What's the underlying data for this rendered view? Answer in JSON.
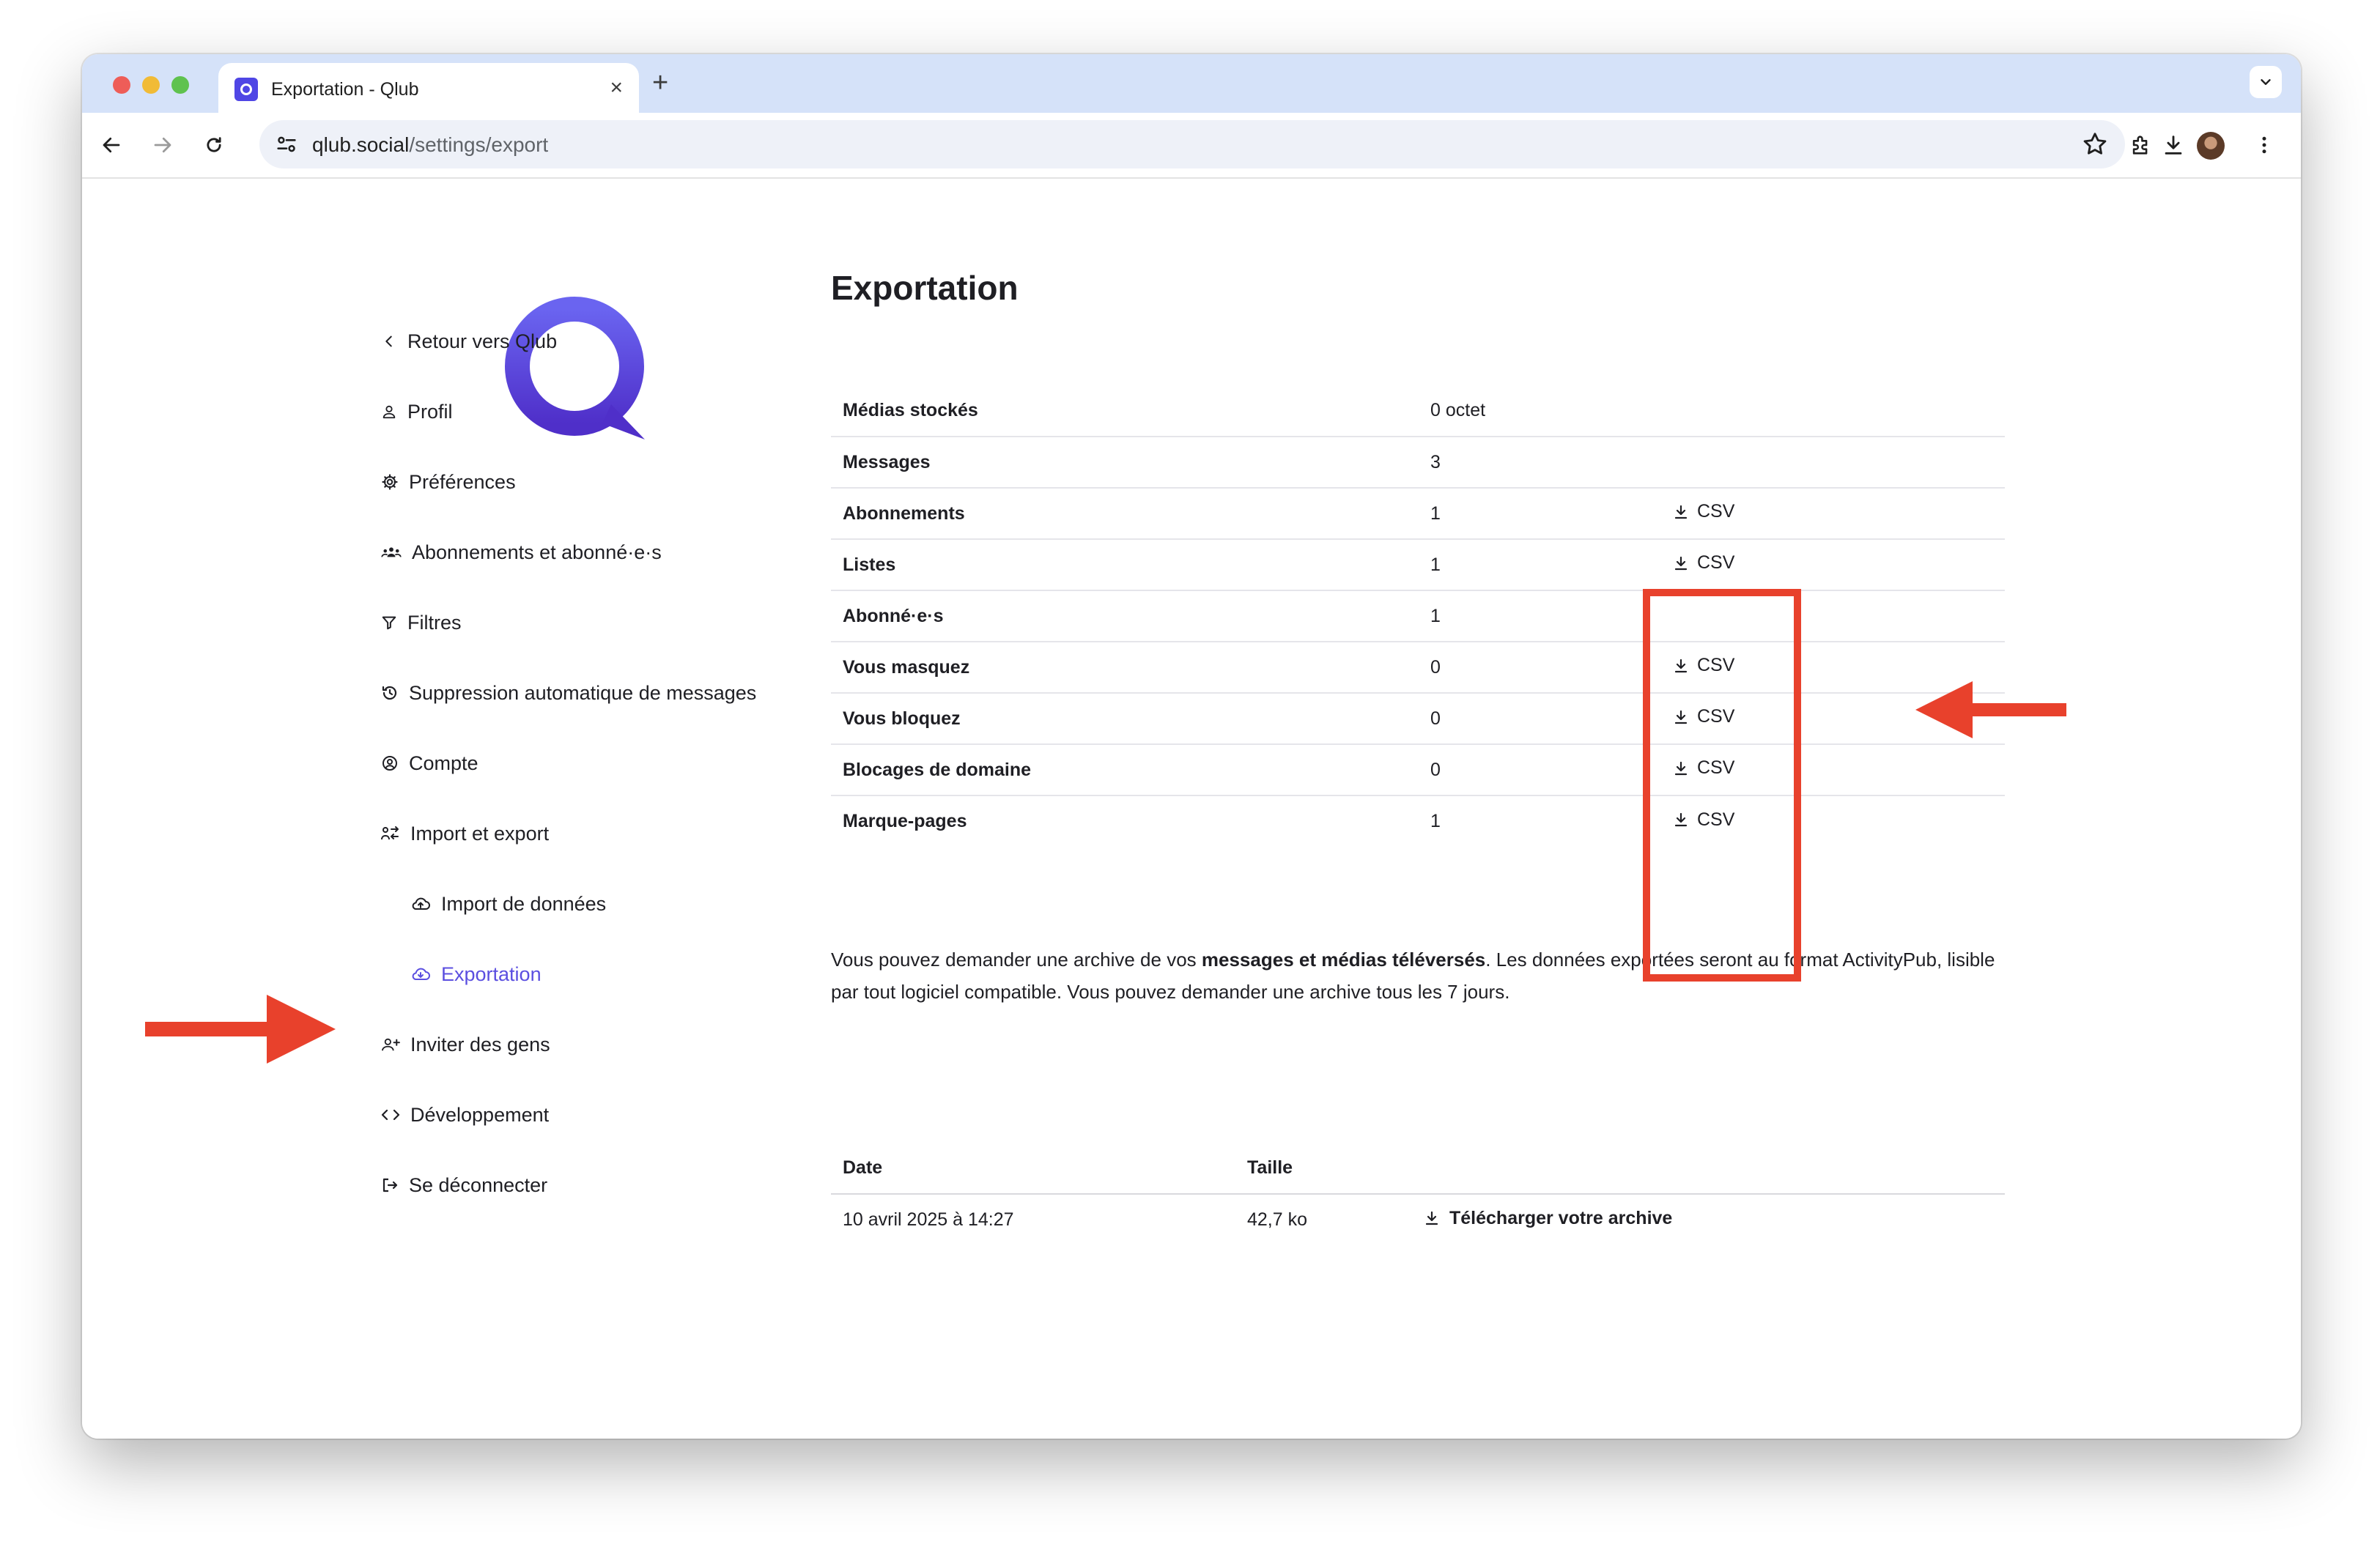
{
  "browser": {
    "tab_title": "Exportation - Qlub",
    "url_host": "qlub.social",
    "url_path": "/settings/export",
    "close_glyph": "×",
    "new_tab_glyph": "+"
  },
  "sidebar": {
    "items": [
      {
        "label": "Retour vers Qlub",
        "icon": "chevron-left-icon"
      },
      {
        "label": "Profil",
        "icon": "user-icon"
      },
      {
        "label": "Préférences",
        "icon": "gear-icon"
      },
      {
        "label": "Abonnements et abonné·e·s",
        "icon": "people-icon"
      },
      {
        "label": "Filtres",
        "icon": "filter-icon"
      },
      {
        "label": "Suppression automatique de messages",
        "icon": "history-icon"
      },
      {
        "label": "Compte",
        "icon": "account-circle-icon"
      },
      {
        "label": "Import et export",
        "icon": "import-export-icon"
      },
      {
        "label": "Import de données",
        "icon": "cloud-upload-icon"
      },
      {
        "label": "Exportation",
        "icon": "cloud-download-icon",
        "active": true
      },
      {
        "label": "Inviter des gens",
        "icon": "person-add-icon"
      },
      {
        "label": "Développement",
        "icon": "code-icon"
      },
      {
        "label": "Se déconnecter",
        "icon": "logout-icon"
      }
    ]
  },
  "main": {
    "title": "Exportation",
    "stats": [
      {
        "label": "Médias stockés",
        "value": "0 octet",
        "csv": ""
      },
      {
        "label": "Messages",
        "value": "3",
        "csv": ""
      },
      {
        "label": "Abonnements",
        "value": "1",
        "csv": "CSV"
      },
      {
        "label": "Listes",
        "value": "1",
        "csv": "CSV"
      },
      {
        "label": "Abonné·e·s",
        "value": "1",
        "csv": ""
      },
      {
        "label": "Vous masquez",
        "value": "0",
        "csv": "CSV"
      },
      {
        "label": "Vous bloquez",
        "value": "0",
        "csv": "CSV"
      },
      {
        "label": "Blocages de domaine",
        "value": "0",
        "csv": "CSV"
      },
      {
        "label": "Marque-pages",
        "value": "1",
        "csv": "CSV"
      }
    ],
    "description": {
      "before": "Vous pouvez demander une archive de vos ",
      "bold": "messages et médias téléversés",
      "after": ". Les données exportées seront au format ActivityPub, lisible par tout logiciel compatible. Vous pouvez demander une archive tous les 7 jours."
    },
    "archive": {
      "headers": [
        "Date",
        "Taille"
      ],
      "row": {
        "date": "10 avril 2025 à 14:27",
        "size": "42,7 ko",
        "link": "Télécharger votre archive"
      }
    }
  },
  "colors": {
    "accent": "#5b4fe0",
    "annotation": "#e8412c",
    "tab_bar": "#d5e2f9"
  }
}
